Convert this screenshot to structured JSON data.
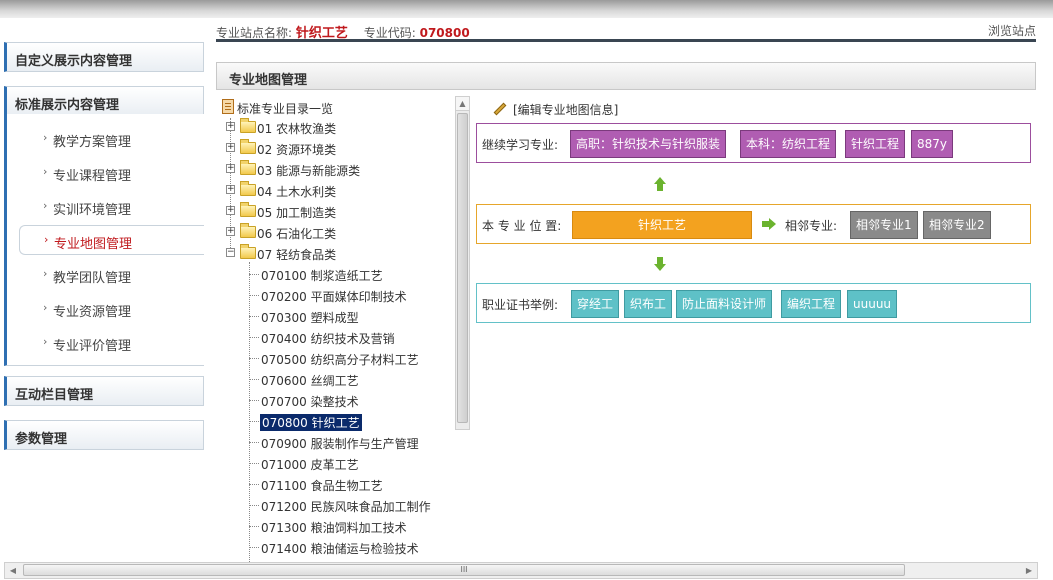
{
  "sidebar": {
    "groups": [
      {
        "label": "自定义展示内容管理"
      },
      {
        "label": "标准展示内容管理"
      },
      {
        "label": "互动栏目管理"
      },
      {
        "label": "参数管理"
      }
    ],
    "items": [
      {
        "label": "教学方案管理"
      },
      {
        "label": "专业课程管理"
      },
      {
        "label": "实训环境管理"
      },
      {
        "label": "专业地图管理"
      },
      {
        "label": "教学团队管理"
      },
      {
        "label": "专业资源管理"
      },
      {
        "label": "专业评价管理"
      }
    ],
    "active_item": "专业地图管理",
    "accent_color": "#2e6fb2",
    "active_color": "#c0191d"
  },
  "header": {
    "site_name_label": "专业站点名称:",
    "site_name": "针织工艺",
    "code_label": "专业代码:",
    "code": "070800",
    "browse_link": "浏览站点"
  },
  "panel": {
    "title": "专业地图管理"
  },
  "tree": {
    "root": "标准专业目录一览",
    "folders": [
      {
        "label": "01 农林牧渔类"
      },
      {
        "label": "02 资源环境类"
      },
      {
        "label": "03 能源与新能源类"
      },
      {
        "label": "04 土木水利类"
      },
      {
        "label": "05 加工制造类"
      },
      {
        "label": "06 石油化工类"
      },
      {
        "label": "07 轻纺食品类"
      }
    ],
    "leaves": [
      {
        "label": "070100 制浆造纸工艺"
      },
      {
        "label": "070200 平面媒体印制技术"
      },
      {
        "label": "070300 塑料成型"
      },
      {
        "label": "070400 纺织技术及营销"
      },
      {
        "label": "070500 纺织高分子材料工艺"
      },
      {
        "label": "070600 丝绸工艺"
      },
      {
        "label": "070700 染整技术"
      },
      {
        "label": "070800 针织工艺"
      },
      {
        "label": "070900 服装制作与生产管理"
      },
      {
        "label": "071000 皮革工艺"
      },
      {
        "label": "071100 食品生物工艺"
      },
      {
        "label": "071200 民族风味食品加工制作"
      },
      {
        "label": "071300 粮油饲料加工技术"
      },
      {
        "label": "071400 粮油储运与检验技术"
      }
    ],
    "selected_leaf": "070800 针织工艺",
    "expanded_folder": "07 轻纺食品类"
  },
  "map": {
    "edit_link": "[编辑专业地图信息]",
    "continue_label": "继续学习专业:",
    "continue_items": [
      "高职：针织技术与针织服装",
      "本科：纺织工程",
      "针织工程",
      "887y"
    ],
    "position_label": "本 专 业 位 置:",
    "position_value": "针织工艺",
    "adjacent_label": "相邻专业:",
    "adjacent_items": [
      "相邻专业1",
      "相邻专业2"
    ],
    "cert_label": "职业证书举例:",
    "cert_items": [
      "穿经工",
      "织布工",
      "防止面料设计师",
      "编织工程",
      "uuuuu"
    ],
    "colors": {
      "continue": "#b05db2",
      "position": "#f3a21f",
      "adjacent": "#8a8a8a",
      "cert": "#5ec1c7",
      "arrow": "#6bb32e"
    }
  },
  "scrollbar": {
    "grip": "III"
  }
}
